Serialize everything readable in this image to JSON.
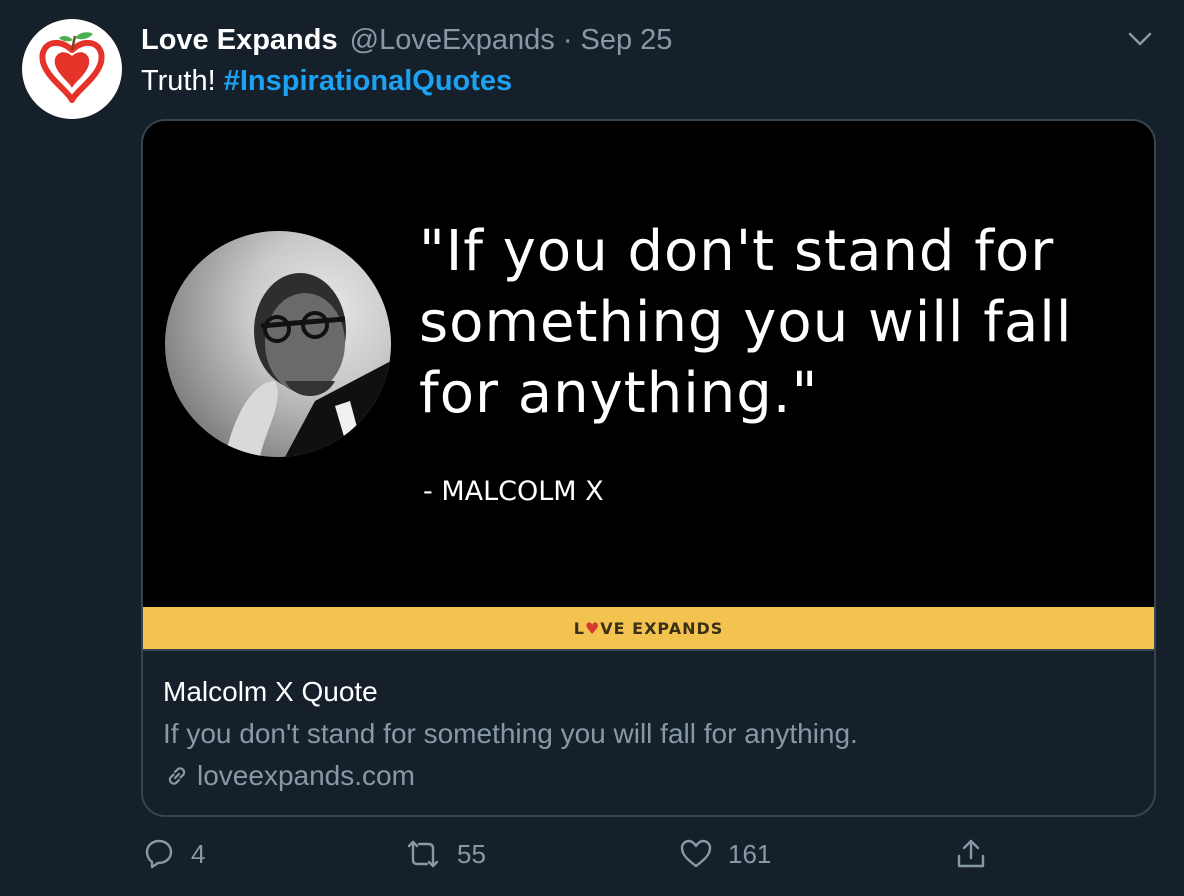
{
  "tweet": {
    "author_name": "Love Expands",
    "author_handle": "@LoveExpands",
    "separator": "·",
    "date": "Sep 25",
    "text_plain": "Truth! ",
    "hashtag": "#InspirationalQuotes"
  },
  "card": {
    "image_quote": "\"If you don't stand for something you will fall for anything.\"",
    "image_author": "- MALCOLM X",
    "brand_left": "L",
    "brand_heart": "♥",
    "brand_right": "VE EXPANDS",
    "title": "Malcolm X Quote",
    "description": "If you don't stand for something you will fall for anything.",
    "domain": "loveexpands.com"
  },
  "actions": {
    "reply_count": "4",
    "retweet_count": "55",
    "like_count": "161"
  },
  "colors": {
    "background": "#15202b",
    "accent": "#1da1f2",
    "secondary_text": "#8899a6",
    "border": "#38444d",
    "brand_bar": "#f2c34e",
    "logo_red": "#e63329"
  },
  "icons": [
    "apple-heart-logo-icon",
    "chevron-down-icon",
    "link-icon",
    "reply-icon",
    "retweet-icon",
    "like-icon",
    "share-icon"
  ]
}
